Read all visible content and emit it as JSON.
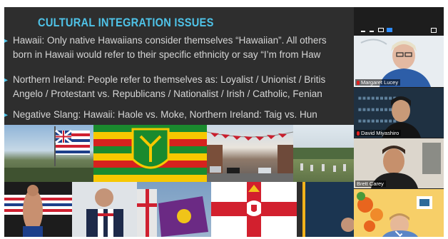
{
  "slide": {
    "title": "CULTURAL INTEGRATION ISSUES",
    "bullet_glyph": "▸",
    "bullets": [
      {
        "line1": "Hawaii: Only native Hawaiians consider themselves “Hawaiian”. All others",
        "line2": "born in Hawaii would refer to their specific ethnicity or say “I’m from Haw"
      },
      {
        "line1": "Northern Ireland: People refer to themselves as: Loyalist / Unionist / Britis",
        "line2": "Angelo / Protestant vs. Republicans / Nationalist / Irish / Catholic, Fenian"
      },
      {
        "line1": "Negative Slang: Hawaii: Haole vs. Moke, Northern Ireland: Taig vs. Hun",
        "line2": ""
      }
    ]
  },
  "participants": [
    {
      "name": "Margaret Lucey",
      "muted": true
    },
    {
      "name": "David Miyashiro",
      "muted": true
    },
    {
      "name": "Brett Carey",
      "muted": false
    },
    {
      "name": "",
      "muted": false
    }
  ],
  "colors": {
    "title": "#4fc3e8",
    "text": "#d6d6d6",
    "slide_bg": "#2e2e2e",
    "panel_bg": "#1d1d1d",
    "zoom_blue": "#2d8cff"
  }
}
